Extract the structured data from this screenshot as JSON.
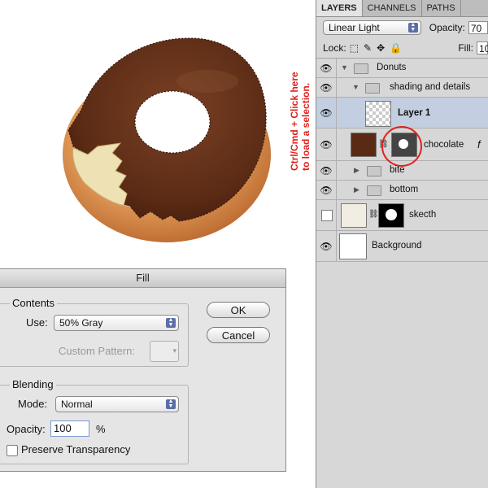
{
  "annotation": {
    "line1": "Ctrl/Cmd + Click here",
    "line2": "to load a selection.",
    "color": "#e0201c"
  },
  "layers_panel": {
    "tabs": [
      "LAYERS",
      "CHANNELS",
      "PATHS"
    ],
    "blend_mode": "Linear Light",
    "opacity_label": "Opacity:",
    "opacity_value": "70",
    "lock_label": "Lock:",
    "fill_label": "Fill:",
    "fill_value": "10",
    "layers": [
      {
        "name": "Donuts",
        "type": "group"
      },
      {
        "name": "shading and details",
        "type": "group"
      },
      {
        "name": "Layer 1",
        "type": "layer",
        "selected": true
      },
      {
        "name": "chocolate",
        "type": "layer",
        "fx": "f"
      },
      {
        "name": "bite",
        "type": "group"
      },
      {
        "name": "bottom",
        "type": "group"
      },
      {
        "name": "skecth",
        "type": "layer"
      },
      {
        "name": "Background",
        "type": "layer"
      }
    ]
  },
  "fill_dialog": {
    "title": "Fill",
    "contents_label": "Contents",
    "use_label": "Use:",
    "use_value": "50% Gray",
    "custom_pattern_label": "Custom Pattern:",
    "blending_label": "Blending",
    "mode_label": "Mode:",
    "mode_value": "Normal",
    "opacity_label": "Opacity:",
    "opacity_value": "100",
    "opacity_unit": "%",
    "preserve_label": "Preserve Transparency",
    "ok_label": "OK",
    "cancel_label": "Cancel"
  },
  "colors": {
    "chocolate": "#5a2a14",
    "dough": "#e0a56a",
    "highlight_row": "#c3cfe0",
    "panel_bg": "#d7d7d7"
  }
}
